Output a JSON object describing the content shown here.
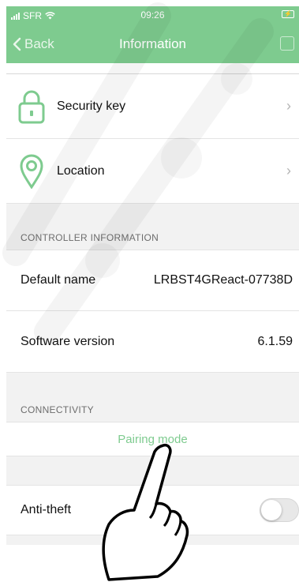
{
  "status_bar": {
    "carrier": "SFR",
    "time": "09:26"
  },
  "nav": {
    "back_label": "Back",
    "title": "Information"
  },
  "menu_rows": [
    {
      "label": "Security key",
      "icon": "lock-icon"
    },
    {
      "label": "Location",
      "icon": "location-pin-icon"
    }
  ],
  "controller_info": {
    "header": "CONTROLLER INFORMATION",
    "rows": [
      {
        "label": "Default name",
        "value": "LRBST4GReact-07738D"
      },
      {
        "label": "Software version",
        "value": "6.1.59"
      }
    ]
  },
  "connectivity": {
    "header": "CONNECTIVITY",
    "pairing_label": "Pairing mode"
  },
  "anti_theft": {
    "label": "Anti-theft",
    "enabled": false
  },
  "colors": {
    "accent": "#7ecb8f",
    "background": "#f2f2f2"
  }
}
